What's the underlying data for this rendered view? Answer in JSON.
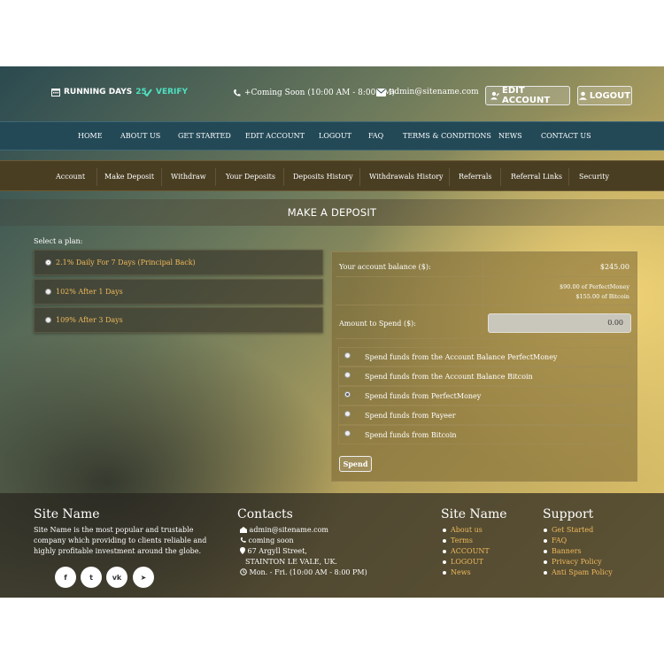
{
  "header": {
    "running_days_label": "RUNNING DAYS",
    "running_days_value": "25",
    "verify_label": "VERIFY",
    "phone_text": "+Coming Soon (10:00 AM - 8:00 PM)",
    "email_text": "admin@sitename.com",
    "edit_account_label": "EDIT ACCOUNT",
    "logout_label": "LOGOUT"
  },
  "main_nav": [
    "HOME",
    "ABOUT US",
    "GET STARTED",
    "EDIT ACCOUNT",
    "LOGOUT",
    "FAQ",
    "TERMS & CONDITIONS",
    "NEWS",
    "CONTACT US"
  ],
  "account_nav": [
    "Account",
    "Make Deposit",
    "Withdraw",
    "Your Deposits",
    "Deposits History",
    "Withdrawals History",
    "Referrals",
    "Referral Links",
    "Security"
  ],
  "page_title": "MAKE A DEPOSIT",
  "plans": {
    "label": "Select a plan:",
    "items": [
      "2.1% Daily For 7 Days (Principal Back)",
      "102% After 1 Days",
      "109% After 3 Days"
    ],
    "selected_index": 0
  },
  "deposit_panel": {
    "balance_label": "Your account balance ($):",
    "balance_value": "$245.00",
    "balance_breakdown": [
      "$90.00 of PerfectMoney",
      "$155.00 of Bitcoin"
    ],
    "amount_label": "Amount to Spend ($):",
    "amount_value": "0.00",
    "options": [
      "Spend funds from the Account Balance PerfectMoney",
      "Spend funds from the Account Balance Bitcoin",
      "Spend funds from PerfectMoney",
      "Spend funds from Payeer",
      "Spend funds from Bitcoin"
    ],
    "selected_option_index": 2,
    "spend_button_label": "Spend"
  },
  "footer": {
    "about_heading": "Site Name",
    "about_text": "Site Name is the most popular and trustable company which providing to clients reliable and highly profitable investment around the globe.",
    "contacts_heading": "Contacts",
    "contacts": {
      "email": "admin@sitename.com",
      "phone": "coming soon",
      "address_line1": "67 Argyll Street,",
      "address_line2": "STAINTON LE VALE, UK.",
      "hours": "Mon. - Fri. (10:00 AM - 8:00 PM)"
    },
    "links_heading": "Site Name",
    "links": [
      "About us",
      "Terms",
      "ACCOUNT",
      "LOGOUT",
      "News"
    ],
    "support_heading": "Support",
    "support_links": [
      "Get Started",
      "FAQ",
      "Banners",
      "Privacy Policy",
      "Anti Spam Policy"
    ],
    "social_icons": [
      "facebook-icon",
      "twitter-icon",
      "vk-icon",
      "telegram-icon"
    ],
    "social_glyphs": [
      "f",
      "t",
      "vk",
      "➤"
    ]
  },
  "colors": {
    "accent_gold": "#f0b95b",
    "accent_teal": "#4fe0c0",
    "main_nav_bg": "#234957",
    "account_nav_bg": "#4a3e22"
  }
}
